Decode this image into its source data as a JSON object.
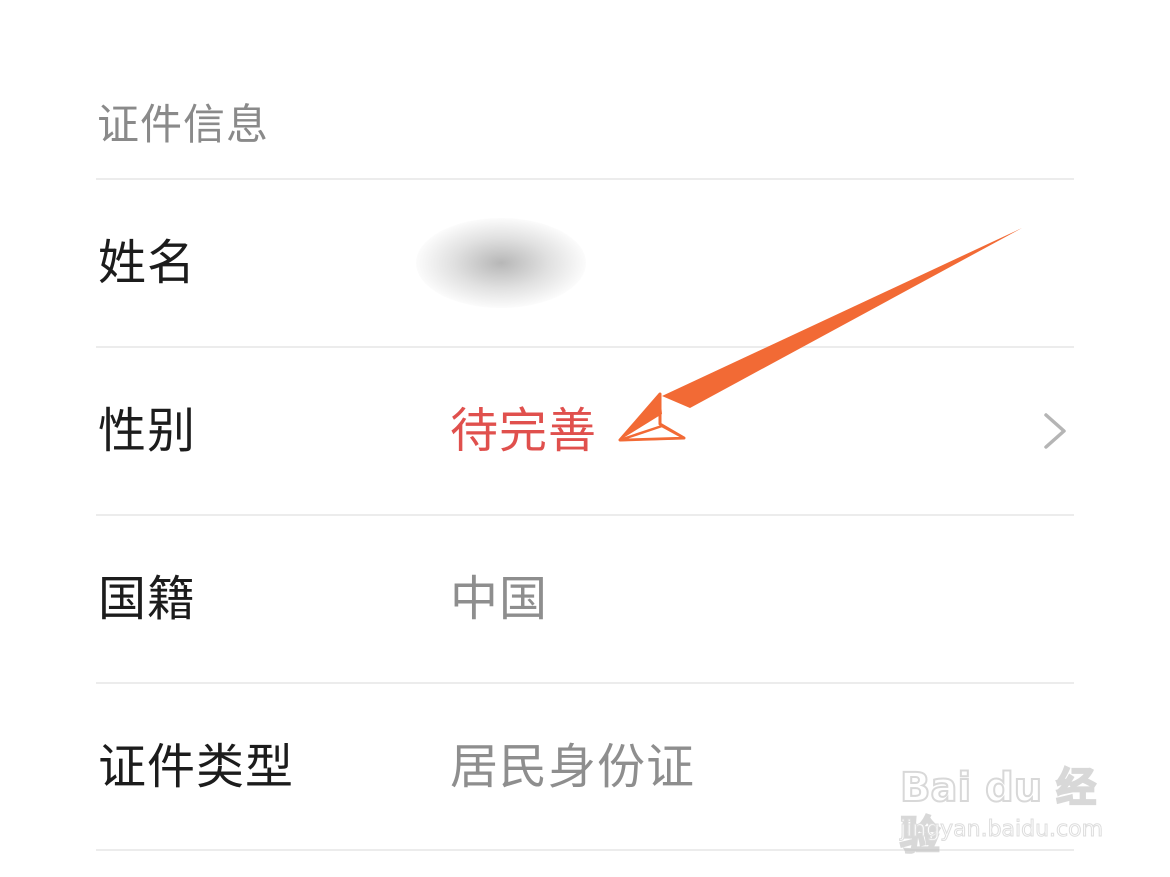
{
  "section": {
    "title": "证件信息"
  },
  "rows": [
    {
      "label": "姓名",
      "value": ""
    },
    {
      "label": "性别",
      "value": "待完善"
    },
    {
      "label": "国籍",
      "value": "中国"
    },
    {
      "label": "证件类型",
      "value": "居民身份证"
    }
  ],
  "icons": {
    "chevron": "chevron-right-icon",
    "annotation": "arrow-icon"
  },
  "colors": {
    "pending": "#e0504d",
    "annotation_arrow": "#f26a35",
    "label": "#1c1c1c",
    "value": "#8e8e8e",
    "divider": "#ececec"
  },
  "watermark": {
    "logo": "Bai du 经验",
    "url": "jingyan.baidu.com"
  }
}
